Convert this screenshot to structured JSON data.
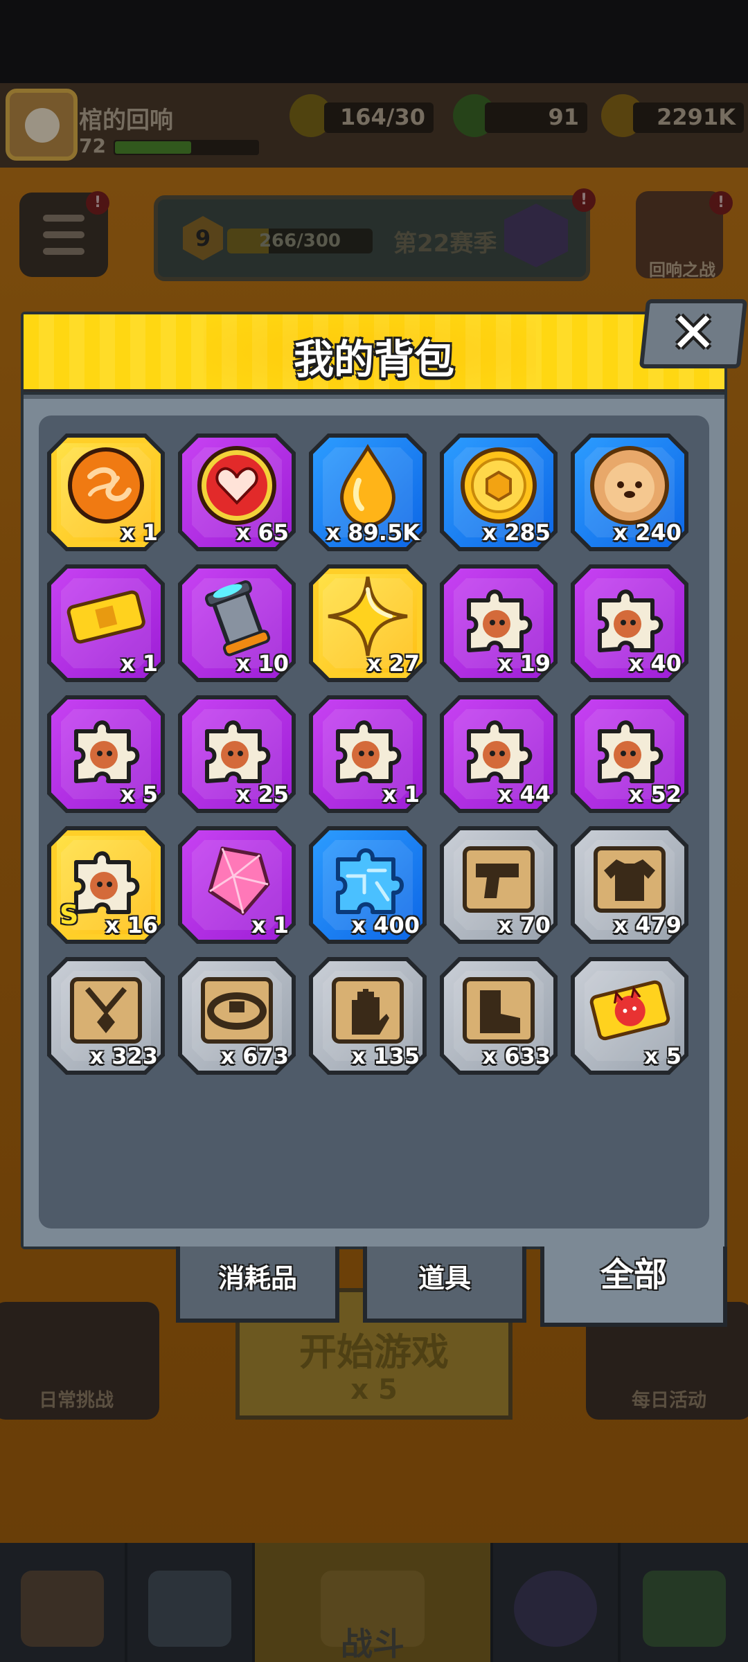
{
  "header": {
    "player_name": "棺的回响",
    "player_level": "72",
    "energy": "164/30",
    "gems": "91",
    "coins": "2291K"
  },
  "season": {
    "level": "9",
    "progress": "266/300",
    "name": "第22赛季"
  },
  "background_buttons": {
    "echo_battle": "回响之战",
    "daily_challenge": "日常挑战",
    "daily_activity": "每日活动",
    "start_game": "开始游戏",
    "start_cost": "x 5",
    "nav_battle": "战斗"
  },
  "modal": {
    "title": "我的背包",
    "close_symbol": "✕",
    "tabs": [
      {
        "label": "消耗品",
        "active": false
      },
      {
        "label": "道具",
        "active": false
      },
      {
        "label": "全部",
        "active": true
      }
    ],
    "items": [
      {
        "name": "orange-orb-item",
        "rarity": "gold",
        "icon": "orange-orb-icon",
        "qty": "x 1"
      },
      {
        "name": "heart-item",
        "rarity": "purple",
        "icon": "heart-icon",
        "qty": "x 65"
      },
      {
        "name": "gold-drop-item",
        "rarity": "blue",
        "icon": "golden-drop-icon",
        "qty": "x 89.5K"
      },
      {
        "name": "coin-item",
        "rarity": "blue",
        "icon": "gold-coin-icon",
        "qty": "x 285"
      },
      {
        "name": "dog-cookie-item",
        "rarity": "blue",
        "icon": "dog-cookie-icon",
        "qty": "x 240"
      },
      {
        "name": "ticket-item",
        "rarity": "purple",
        "icon": "gold-ticket-icon",
        "qty": "x 1"
      },
      {
        "name": "canister-item",
        "rarity": "purple",
        "icon": "canister-icon",
        "qty": "x 10"
      },
      {
        "name": "star-item",
        "rarity": "gold",
        "icon": "gold-star-icon",
        "qty": "x 27"
      },
      {
        "name": "puzzle-piece-item",
        "rarity": "purple",
        "icon": "puzzle-hero-icon",
        "qty": "x 19"
      },
      {
        "name": "puzzle-piece-item",
        "rarity": "purple",
        "icon": "puzzle-hero-icon",
        "qty": "x 40"
      },
      {
        "name": "puzzle-piece-item",
        "rarity": "purple",
        "icon": "puzzle-hero-icon",
        "qty": "x 5"
      },
      {
        "name": "puzzle-piece-item",
        "rarity": "purple",
        "icon": "puzzle-hero-icon",
        "qty": "x 25"
      },
      {
        "name": "puzzle-piece-item",
        "rarity": "purple",
        "icon": "puzzle-hero-icon",
        "qty": "x 1"
      },
      {
        "name": "puzzle-piece-item",
        "rarity": "purple",
        "icon": "puzzle-hero-icon",
        "qty": "x 44"
      },
      {
        "name": "puzzle-piece-item",
        "rarity": "purple",
        "icon": "puzzle-hero-icon",
        "qty": "x 52"
      },
      {
        "name": "s-puzzle-piece-item",
        "rarity": "gold",
        "icon": "puzzle-hero-icon",
        "qty": "x 16",
        "grade": "S"
      },
      {
        "name": "pink-crystal-item",
        "rarity": "purple",
        "icon": "pink-crystal-icon",
        "qty": "x 1"
      },
      {
        "name": "blue-puzzle-item",
        "rarity": "blue",
        "icon": "blue-puzzle-icon",
        "qty": "x 400"
      },
      {
        "name": "blueprint-weapon-item",
        "rarity": "gray",
        "icon": "blueprint-gun-icon",
        "qty": "x 70"
      },
      {
        "name": "blueprint-armor-item",
        "rarity": "gray",
        "icon": "blueprint-shirt-icon",
        "qty": "x 479"
      },
      {
        "name": "blueprint-necklace-item",
        "rarity": "gray",
        "icon": "blueprint-necklace-icon",
        "qty": "x 323"
      },
      {
        "name": "blueprint-belt-item",
        "rarity": "gray",
        "icon": "blueprint-belt-icon",
        "qty": "x 673"
      },
      {
        "name": "blueprint-glove-item",
        "rarity": "gray",
        "icon": "blueprint-glove-icon",
        "qty": "x 135"
      },
      {
        "name": "blueprint-boots-item",
        "rarity": "gray",
        "icon": "blueprint-boots-icon",
        "qty": "x 633"
      },
      {
        "name": "devil-ticket-item",
        "rarity": "gray",
        "icon": "devil-ticket-icon",
        "qty": "x 5"
      }
    ]
  },
  "colors": {
    "header_yellow": "#ffd712",
    "rarity_gold": "#ffcf28",
    "rarity_purple": "#b02ee2",
    "rarity_blue": "#1a7ef2",
    "rarity_gray": "#aeb5bf"
  }
}
